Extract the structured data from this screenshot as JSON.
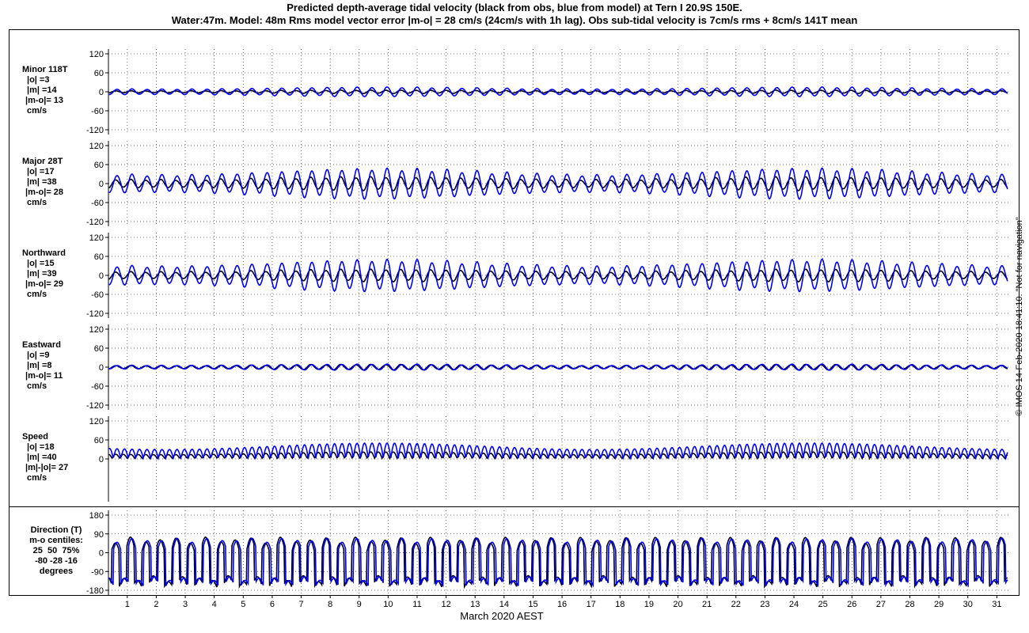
{
  "header": {
    "title_line1": "Predicted depth-average tidal velocity (black from obs, blue from model) at Tern I 20.9S 150E.",
    "title_line2": "Water:47m. Model: 48m  Rms model vector error |m-o| = 28 cm/s (24cm/s with 1h lag). Obs sub-tidal velocity is 7cm/s rms + 8cm/s 141T mean"
  },
  "credit": "© IMOS 14-Feb-2020 18:41:10. \"Not for navigation\"",
  "colors": {
    "obs": "#000000",
    "model": "#0000ff",
    "grid": "#555555"
  },
  "chart_data": {
    "type": "line",
    "xlabel": "March 2020 AEST",
    "xlim": [
      0.35,
      31.4
    ],
    "x_ticks": [
      "1",
      "2",
      "3",
      "4",
      "5",
      "6",
      "7",
      "8",
      "9",
      "10",
      "11",
      "12",
      "13",
      "14",
      "15",
      "16",
      "17",
      "18",
      "19",
      "20",
      "21",
      "22",
      "23",
      "24",
      "25",
      "26",
      "27",
      "28",
      "29",
      "30",
      "31"
    ],
    "series_names": [
      "obs",
      "model"
    ],
    "panels": [
      {
        "id": "minor",
        "label_lines": [
          "Minor 118T",
          "|o| =3",
          "|m| =14",
          "|m-o|= 13",
          "cm/s"
        ],
        "ylim": [
          -120,
          120
        ],
        "y_ticks": [
          "-120",
          "-60",
          "0",
          "60",
          "120"
        ],
        "obs_amp": 5,
        "model_amp": 14,
        "shape": "sine"
      },
      {
        "id": "major",
        "label_lines": [
          "Major 28T",
          "|o| =17",
          "|m| =38",
          "|m-o|= 28",
          "cm/s"
        ],
        "ylim": [
          -120,
          120
        ],
        "y_ticks": [
          "-120",
          "-60",
          "0",
          "60",
          "120"
        ],
        "obs_amp": 20,
        "model_amp": 45,
        "shape": "sine"
      },
      {
        "id": "northward",
        "label_lines": [
          "Northward",
          "|o| =15",
          "|m| =39",
          "|m-o|= 29",
          "cm/s"
        ],
        "ylim": [
          -120,
          120
        ],
        "y_ticks": [
          "-120",
          "-60",
          "0",
          "60",
          "120"
        ],
        "obs_amp": 18,
        "model_amp": 47,
        "shape": "sine"
      },
      {
        "id": "eastward",
        "label_lines": [
          "Eastward",
          "|o| =9",
          "|m| =8",
          "|m-o|= 11",
          "cm/s"
        ],
        "ylim": [
          -120,
          120
        ],
        "y_ticks": [
          "-120",
          "-60",
          "0",
          "60",
          "120"
        ],
        "obs_amp": 8,
        "model_amp": 9,
        "shape": "sine"
      },
      {
        "id": "speed",
        "label_lines": [
          "Speed",
          "|o| =18",
          "|m| =40",
          "|m|-|o|= 27",
          "cm/s"
        ],
        "ylim": [
          -120,
          120
        ],
        "y_ticks": [
          "0",
          "60",
          "120"
        ],
        "obs_amp": 20,
        "model_amp": 48,
        "shape": "speed"
      },
      {
        "id": "direction",
        "label_lines": [
          "Direction (T)",
          "m-o centiles:",
          "25  50  75%",
          "-80 -28 -16",
          "degrees"
        ],
        "ylim": [
          -180,
          180
        ],
        "y_ticks": [
          "-180",
          "-90",
          "0",
          "90",
          "180"
        ],
        "shape": "direction"
      }
    ]
  }
}
